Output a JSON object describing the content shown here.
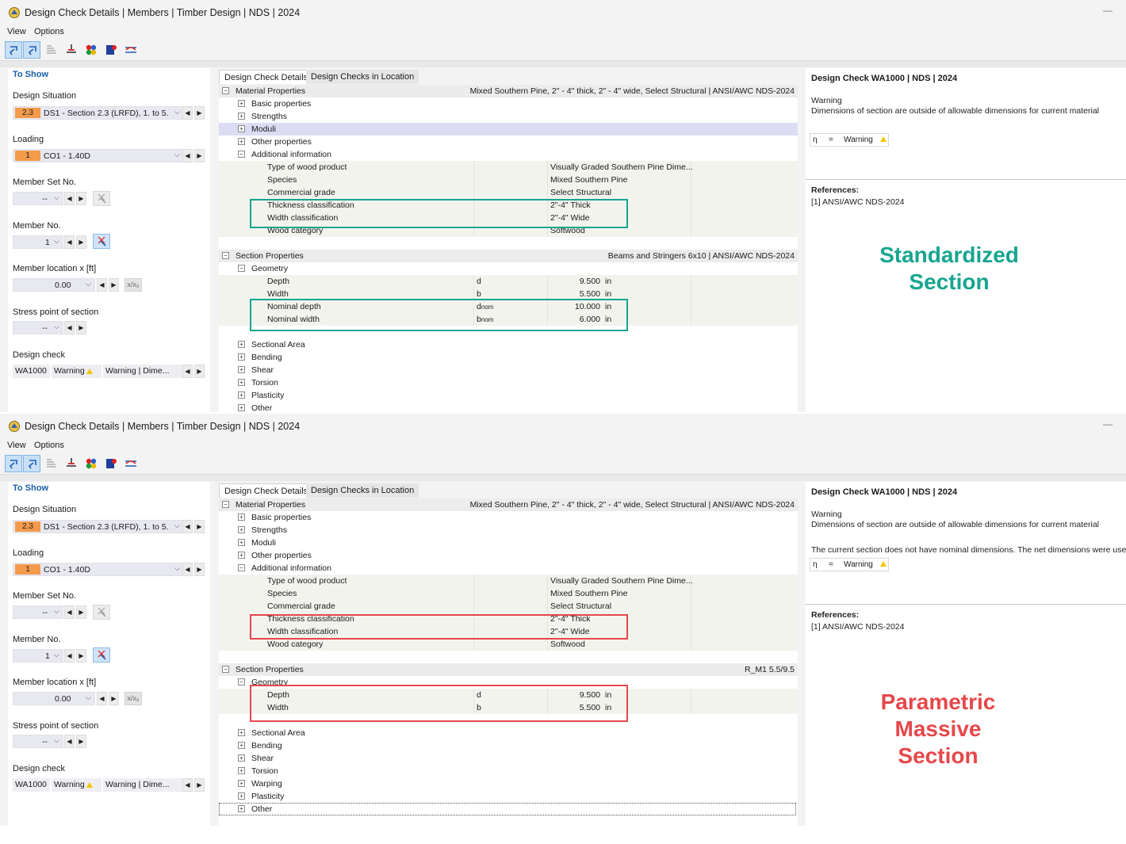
{
  "colors": {
    "green": "#17a58f",
    "red": "#e6474a",
    "badge": "#f39a4b",
    "link_blue": "#1a5fa8"
  },
  "window": {
    "title": "Design Check Details | Members | Timber Design | NDS | 2024",
    "menu": [
      "View",
      "Options"
    ],
    "minimize_icon": "—",
    "toolbar_icons": [
      "select-member-icon",
      "select-set-icon",
      "table-icon",
      "beam-icon",
      "color-balls-icon",
      "book-icon",
      "stress-diagram-icon"
    ]
  },
  "left": {
    "title": "To Show",
    "design_situation": {
      "label": "Design Situation",
      "badge": "2.3",
      "value": "DS1 - Section 2.3 (LRFD), 1. to 5."
    },
    "loading": {
      "label": "Loading",
      "badge": "1",
      "value": "CO1 - 1.40D"
    },
    "member_set": {
      "label": "Member Set No.",
      "value": "--"
    },
    "member": {
      "label": "Member No.",
      "value": "1"
    },
    "location": {
      "label": "Member location x [ft]",
      "value": "0.00",
      "btn": "x/x₀"
    },
    "stress_point": {
      "label": "Stress point of section",
      "value": "--"
    },
    "design_check": {
      "label": "Design check",
      "id": "WA1000",
      "type": "Warning",
      "desc": "Warning | Dime..."
    }
  },
  "tabs": [
    "Design Check Details",
    "Design Checks in Location"
  ],
  "material": {
    "header": "Material Properties",
    "header_right": "Mixed Southern Pine, 2\" - 4\" thick, 2\" - 4\" wide, Select Structural | ANSI/AWC NDS-2024",
    "groups": [
      "Basic properties",
      "Strengths",
      "Moduli",
      "Other properties"
    ],
    "additional": "Additional information",
    "items": [
      {
        "label": "Type of wood product",
        "value": "Visually Graded Southern Pine Dime..."
      },
      {
        "label": "Species",
        "value": "Mixed Southern Pine"
      },
      {
        "label": "Commercial grade",
        "value": "Select Structural"
      },
      {
        "label": "Thickness classification",
        "value": "2\"-4\" Thick"
      },
      {
        "label": "Width classification",
        "value": "2\"-4\" Wide"
      },
      {
        "label": "Wood category",
        "value": "Softwood"
      }
    ]
  },
  "section": {
    "header": "Section Properties",
    "geometry_label": "Geometry",
    "top_right": "Beams and Stringers 6x10 | ANSI/AWC NDS-2024",
    "bottom_right": "R_M1 5.5/9.5",
    "depth": {
      "label": "Depth",
      "sym": "d",
      "value": "9.500",
      "unit": "in"
    },
    "width": {
      "label": "Width",
      "sym": "b",
      "value": "5.500",
      "unit": "in"
    },
    "nominal_depth": {
      "label": "Nominal depth",
      "sym": "d",
      "sub": "nom",
      "value": "10.000",
      "unit": "in"
    },
    "nominal_width": {
      "label": "Nominal width",
      "sym": "b",
      "sub": "nom",
      "value": "6.000",
      "unit": "in"
    }
  },
  "checks_top": [
    "Sectional Area",
    "Bending",
    "Shear",
    "Torsion",
    "Plasticity",
    "Other"
  ],
  "checks_bottom": [
    "Sectional Area",
    "Bending",
    "Shear",
    "Torsion",
    "Warping",
    "Plasticity",
    "Other"
  ],
  "right": {
    "title": "Design Check WA1000 | NDS | 2024",
    "warning": "Warning",
    "message": "Dimensions of section are outside of allowable dimensions for current material",
    "extra_message": "The current section does not have nominal dimensions. The net dimensions were used.",
    "eta_symbol": "η",
    "eta_eq": "=",
    "eta_value": "Warning",
    "refs_title": "References:",
    "ref": "[1]  ANSI/AWC NDS-2024"
  },
  "annotations": {
    "top_lines": [
      "Standardized",
      "Section"
    ],
    "bottom_lines": [
      "Parametric",
      "Massive",
      "Section"
    ]
  }
}
